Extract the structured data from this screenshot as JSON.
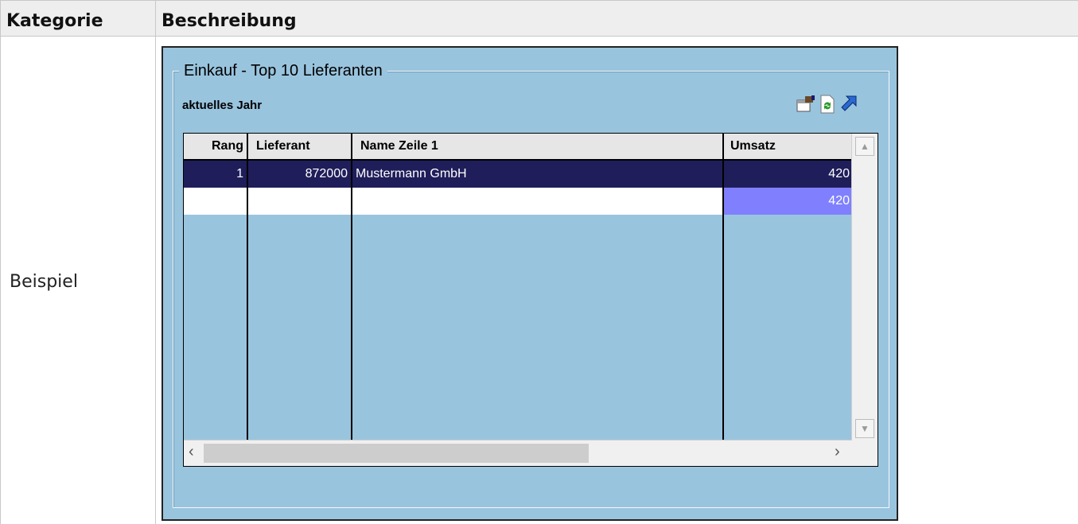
{
  "doc": {
    "header_col1": "Kategorie",
    "header_col2": "Beschreibung",
    "row_label": "Beispiel"
  },
  "widget": {
    "group_title": "Einkauf - Top 10 Lieferanten",
    "subtitle": "aktuelles Jahr",
    "toolbar": [
      {
        "icon": "settings-icon"
      },
      {
        "icon": "refresh-icon"
      },
      {
        "icon": "export-arrow-icon"
      }
    ],
    "grid": {
      "columns": [
        "Rang",
        "Lieferant",
        "Name Zeile 1",
        "Umsatz"
      ],
      "rows": [
        {
          "rang": "1",
          "lieferant": "872000",
          "name": "Mustermann GmbH",
          "umsatz": "420"
        }
      ],
      "total_umsatz": "420"
    },
    "scroll": {
      "up": "▲",
      "down": "▼",
      "left": "‹",
      "right": "›"
    }
  },
  "colors": {
    "widget_bg": "#99c4de",
    "selected_row": "#1f1e5a",
    "sum_cell": "#8080ff"
  }
}
